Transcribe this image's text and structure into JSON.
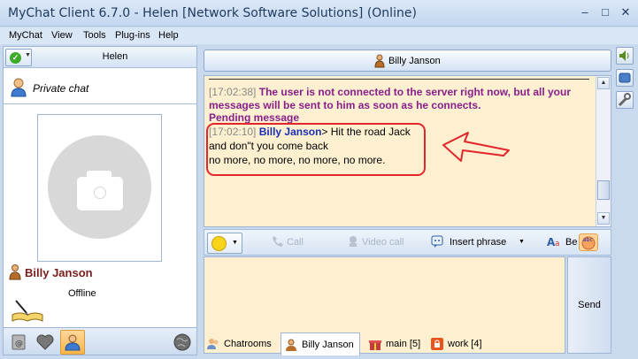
{
  "window": {
    "title": "MyChat Client 6.7.0 - Helen [Network Software Solutions] (Online)",
    "minimize": "–",
    "maximize": "□",
    "close": "✕"
  },
  "menu": [
    "MyChat",
    "View",
    "Tools",
    "Plug-ins",
    "Help"
  ],
  "sidebar": {
    "current_user": "Helen",
    "private_chat_label": "Private chat",
    "contact": {
      "name": "Billy Janson",
      "status": "Offline"
    },
    "bottom_icons": [
      "mail-icon",
      "heart-icon",
      "contacts-icon",
      "globe-icon"
    ]
  },
  "chat": {
    "header_name": "Billy Janson",
    "messages": [
      {
        "time": "[17:02:38]",
        "text_line1": "The user is not connected to the server right now, but all your",
        "text_line2": "messages will be sent to him as soon as he connects.",
        "text_line3": "Pending message"
      },
      {
        "time": "[17:02:10]",
        "nick": "Billy Janson",
        "line1": "> Hit the road Jack",
        "line2": "and don\"t you come back",
        "line3": "no  more, no more, no more, no more."
      }
    ]
  },
  "toolbar": {
    "call": "Call",
    "video_call": "Video call",
    "insert_phrase": "Insert phrase",
    "overflow": "Be"
  },
  "send_label": "Send",
  "tabs": [
    {
      "label": "Chatrooms",
      "icon": "chatrooms-icon"
    },
    {
      "label": "Billy Janson",
      "icon": "user-icon"
    },
    {
      "label": "main [5]",
      "icon": "gift-icon"
    },
    {
      "label": "work [4]",
      "icon": "lock-icon"
    }
  ],
  "colors": {
    "chat_bg": "#fcf0d0",
    "system_text": "#8a1f8a",
    "nick": "#1a2fb8",
    "contact_name": "#7a1c1c",
    "highlight": "#e2262c",
    "online": "#3cab2a"
  }
}
